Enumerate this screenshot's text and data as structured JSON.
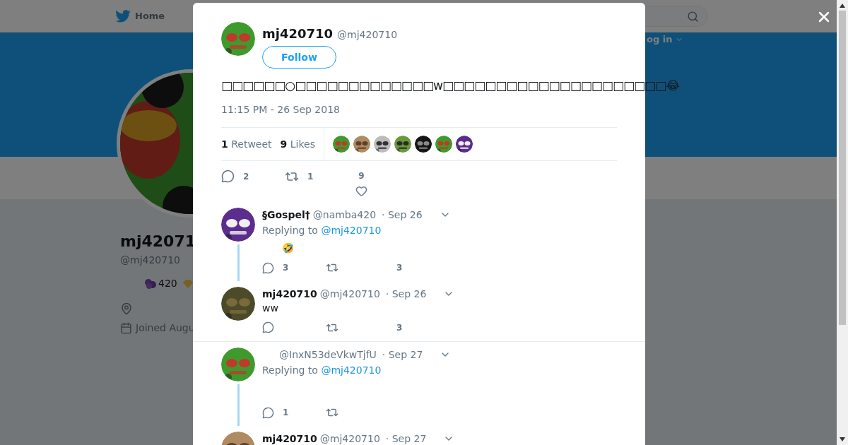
{
  "nav": {
    "home": "Home",
    "login": "og in"
  },
  "profile": {
    "name": "mj42071",
    "handle": "@mj420710",
    "bio": "420",
    "joined": "Joined Augu"
  },
  "tweet": {
    "name": "mj420710",
    "handle": "@mj420710",
    "follow": "Follow",
    "text": "□□□□□□○□□□□□□□□□□□□□w□□□□□□□□□□□□□□□□□□□□□😂",
    "time": "11:15 PM - 26 Sep 2018",
    "stats": [
      {
        "count": "1",
        "label": "Retweet"
      },
      {
        "count": "9",
        "label": "Likes"
      }
    ],
    "actions": {
      "replies": "2",
      "retweets": "1",
      "likes": "9"
    }
  },
  "replies": [
    {
      "name": "§Gospel†",
      "handle": "@namba420",
      "date": "· Sep 26",
      "replying_label": "Replying to",
      "replying_to": "@mj420710",
      "text": "🤣",
      "replies": "3",
      "likes": "3",
      "thread": true,
      "separator": false
    },
    {
      "name": "mj420710",
      "handle": "@mj420710",
      "date": "· Sep 26",
      "text": "ww",
      "likes": "3",
      "thread": false,
      "separator": true
    },
    {
      "handle": "@InxN53deVkwTjfU",
      "date": "· Sep 27",
      "replying_label": "Replying to",
      "replying_to": "@mj420710",
      "replies": "1",
      "thread": true,
      "separator": false
    },
    {
      "name": "mj420710",
      "handle": "@mj420710",
      "date": "· Sep 27",
      "thread": false,
      "separator": false
    }
  ]
}
